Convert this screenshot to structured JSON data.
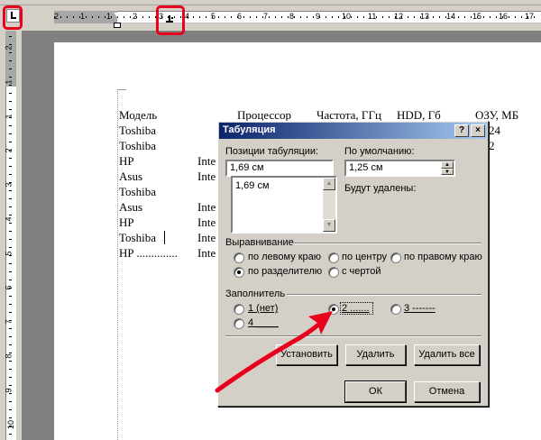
{
  "ruler": {
    "h_numbers": [
      "2",
      "1",
      "1",
      "2",
      "3",
      "4",
      "5",
      "6",
      "7",
      "8",
      "9",
      "10",
      "11",
      "12",
      "13",
      "14",
      "15",
      "16",
      "17"
    ],
    "v_numbers": [
      "2",
      "1",
      "1",
      "2",
      "3",
      "4",
      "5",
      "6",
      "7",
      "8",
      "9",
      "10"
    ]
  },
  "document": {
    "header": [
      "Модель",
      "Процессор",
      "Частота, ГГц",
      "HDD, Гб",
      "ОЗУ, МБ"
    ],
    "rows": [
      {
        "model": "Toshiba",
        "proc": "",
        "tail": "24"
      },
      {
        "model": "Toshiba",
        "proc": "",
        "tail": "2"
      },
      {
        "model": "HP",
        "proc": "Inte",
        "tail": ""
      },
      {
        "model": "Asus",
        "proc": "Inte",
        "tail": ""
      },
      {
        "model": "Toshiba",
        "proc": "",
        "tail": ""
      },
      {
        "model": "Asus",
        "proc": "Inte",
        "tail": ""
      },
      {
        "model": "HP",
        "proc": "Inte",
        "tail": ""
      },
      {
        "model": "Toshiba",
        "proc": "Inte",
        "tail": ""
      },
      {
        "model": "HP ..............",
        "proc": "Inte",
        "tail": ""
      }
    ]
  },
  "dialog": {
    "title": "Табуляция",
    "help": "?",
    "close": "×",
    "positions_label": "Позиции табуляции:",
    "positions_value": "1,69 см",
    "positions_list": [
      "1,69 см"
    ],
    "default_label": "По умолчанию:",
    "default_value": "1,25 см",
    "to_delete_label": "Будут удалены:",
    "alignment_label": "Выравнивание",
    "alignment_options": [
      "по левому краю",
      "по центру",
      "по правому краю",
      "по разделителю",
      "с чертой"
    ],
    "alignment_selected": "по разделителю",
    "leader_label": "Заполнитель",
    "leader_options": [
      "1 (нет)",
      "2 .......",
      "3 -------",
      "4 ____"
    ],
    "leader_selected": "2 .......",
    "set_button": "Установить",
    "delete_button": "Удалить",
    "delete_all_button": "Удалить все",
    "ok_button": "ОК",
    "cancel_button": "Отмена"
  },
  "colors": {
    "annotation": "#e8001c",
    "titlebar_start": "#0a246a",
    "titlebar_end": "#a6caf0",
    "dialog_bg": "#d4d0c8"
  }
}
